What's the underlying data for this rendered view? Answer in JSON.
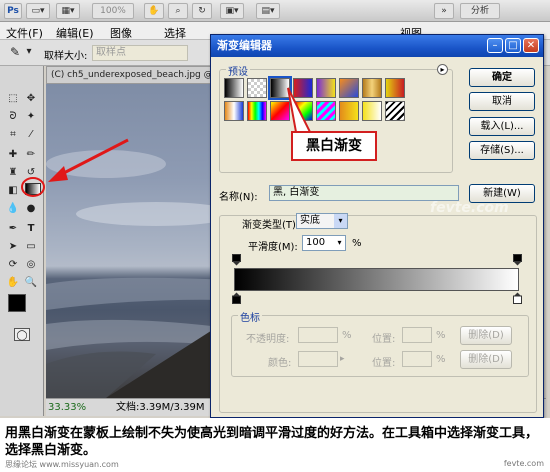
{
  "app": {
    "zoom_readout": "100%",
    "analysis_menu": "分析",
    "menus": [
      "文件(F)",
      "编辑(E)",
      "图像",
      "选择"
    ],
    "menu_right": "视图"
  },
  "options_bar": {
    "sample_size_label": "取样大小:",
    "sample_size_value": "取样点"
  },
  "document": {
    "tab_label": "(C) ch5_underexposed_beach.jpg @ 33",
    "zoom": "33.33%",
    "doc_size": "文档:3.39M/3.39M"
  },
  "dialog": {
    "title": "渐变编辑器",
    "presets_label": "预设",
    "buttons": {
      "ok": "确定",
      "cancel": "取消",
      "load": "载入(L)...",
      "save": "存储(S)...",
      "new": "新建(W)",
      "delete_opacity": "删除(D)",
      "delete_color": "删除(D)"
    },
    "name_label": "名称(N):",
    "name_value": "黑, 白渐变",
    "gradient_type_label": "渐变类型(T):",
    "gradient_type_value": "实底",
    "smoothness_label": "平滑度(M):",
    "smoothness_value": "100",
    "percent": "%",
    "stops_label": "色标",
    "opacity_label": "不透明度:",
    "location_label": "位置:",
    "color_label": "颜色:",
    "callout": "黑白渐变"
  },
  "caption": "用黑白渐变在蒙板上绘制不失为使高光到暗调平滑过度的好方法。在工具箱中选择渐变工具，选择黑白渐变。",
  "footer_left": "思缘论坛  www.missyuan.com",
  "footer_right": "fevte.com",
  "watermark": "fevte.com",
  "colors": {
    "title_bar": "#1a55c8",
    "callout_border": "#d21f1f",
    "arrow": "#e01818"
  }
}
